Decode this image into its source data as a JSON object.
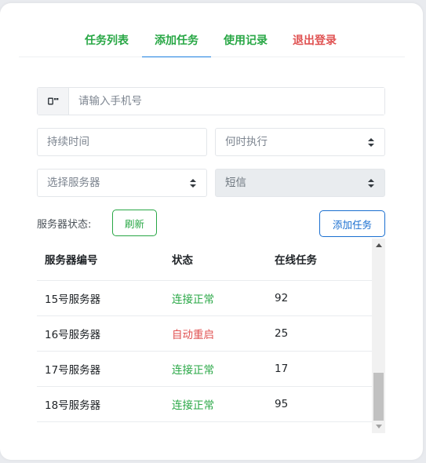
{
  "nav": {
    "tabs": [
      {
        "label": "任务列表",
        "active": false
      },
      {
        "label": "添加任务",
        "active": true
      },
      {
        "label": "使用记录",
        "active": false
      },
      {
        "label": "退出登录",
        "active": false
      }
    ]
  },
  "form": {
    "phone_placeholder": "请输入手机号",
    "phone_icon": "phone-icon",
    "duration_placeholder": "持续时间",
    "exec_time_select": "何时执行",
    "server_select": "选择服务器",
    "type_select": "短信"
  },
  "status": {
    "label": "服务器状态:",
    "refresh_label": "刷新",
    "add_task_label": "添加任务"
  },
  "table": {
    "headers": [
      "服务器编号",
      "状态",
      "在线任务"
    ],
    "rows": [
      {
        "server": "15号服务器",
        "state": "连接正常",
        "tasks": "92"
      },
      {
        "server": "16号服务器",
        "state": "自动重启",
        "tasks": "25"
      },
      {
        "server": "17号服务器",
        "state": "连接正常",
        "tasks": "17"
      },
      {
        "server": "18号服务器",
        "state": "连接正常",
        "tasks": "95"
      }
    ]
  },
  "colors": {
    "green": "#28a745",
    "red": "#e05252",
    "blue": "#1a6fd0"
  }
}
